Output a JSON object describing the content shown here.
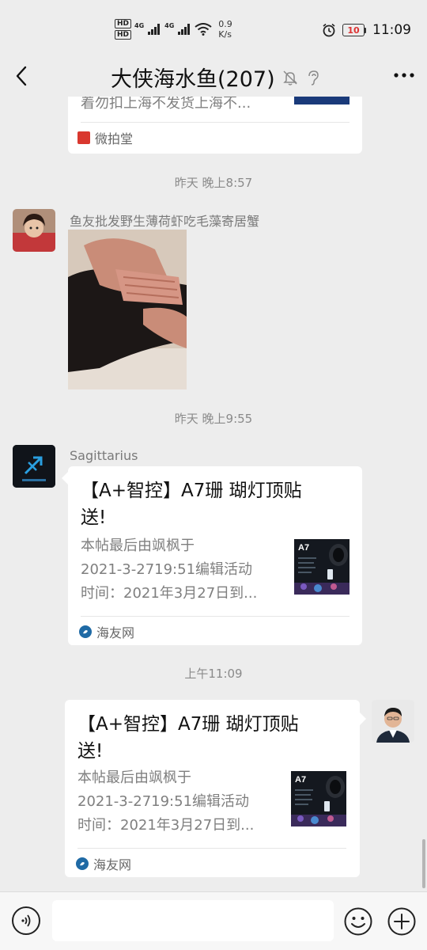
{
  "status_bar": {
    "hd1": "HD",
    "hd2": "HD",
    "net1": "4G",
    "net2": "4G",
    "speed_value": "0.9",
    "speed_unit": "K/s",
    "battery": "10",
    "time": "11:09"
  },
  "header": {
    "title": "大侠海水鱼(207)"
  },
  "messages": {
    "top_card": {
      "desc_line": "着勿扣上海不发货上海不...",
      "source": "微拍堂"
    },
    "time1": "昨天 晚上8:57",
    "msg1": {
      "sender": "鱼友批发野生薄荷虾吃毛藻寄居蟹"
    },
    "time2": "昨天 晚上9:55",
    "msg2": {
      "sender": "Sagittarius",
      "title_line1": "【A+智控】A7珊 瑚灯顶贴",
      "title_line2": "送!",
      "desc_line1": "本帖最后由飒枫于",
      "desc_line2": "2021-3-2719:51编辑活动",
      "desc_line3": "时间：2021年3月27日到...",
      "source": "海友网",
      "thumb_label": "A7"
    },
    "time3": "上午11:09",
    "msg3": {
      "title_line1": "【A+智控】A7珊 瑚灯顶贴",
      "title_line2": "送!",
      "desc_line1": "本帖最后由飒枫于",
      "desc_line2": "2021-3-2719:51编辑活动",
      "desc_line3": "时间：2021年3月27日到...",
      "source": "海友网",
      "thumb_label": "A7"
    }
  }
}
